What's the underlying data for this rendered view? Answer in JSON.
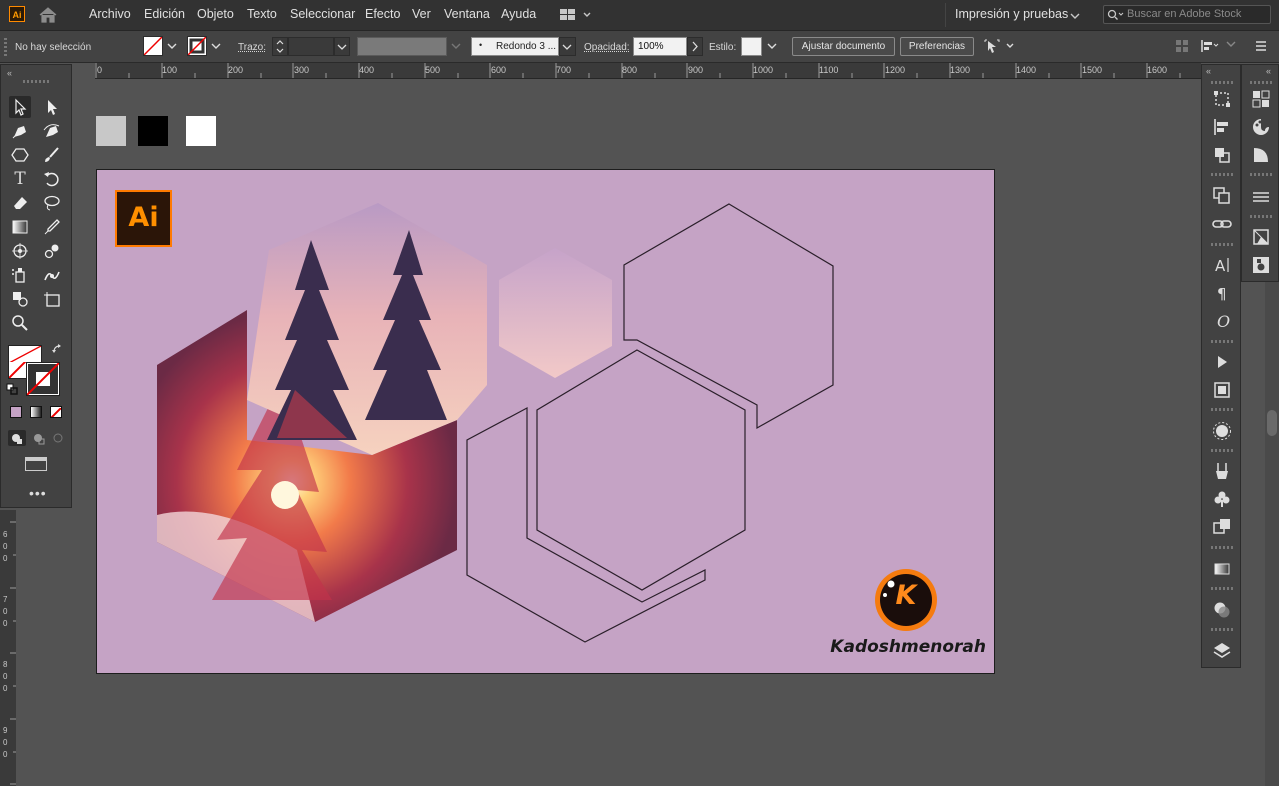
{
  "app": {
    "badge": "Ai",
    "brand_color": "#ff9a00"
  },
  "menu": {
    "items": [
      "Archivo",
      "Edición",
      "Objeto",
      "Texto",
      "Seleccionar",
      "Efecto",
      "Ver",
      "Ventana",
      "Ayuda"
    ],
    "workspace": "Impresión y pruebas",
    "search_placeholder": "Buscar en Adobe Stock"
  },
  "control": {
    "selection": "No hay selección",
    "stroke_label": "Trazo:",
    "brush": "Redondo 3 ...",
    "opacity_label": "Opacidad:",
    "opacity": "100%",
    "style_label": "Estilo:",
    "fit_doc": "Ajustar documento",
    "prefs": "Preferencias"
  },
  "ruler": {
    "top": [
      "0",
      "100",
      "200",
      "300",
      "400",
      "500",
      "600",
      "700",
      "800",
      "900",
      "1000",
      "1100",
      "1200",
      "1300",
      "1400",
      "1500",
      "1600"
    ],
    "left": [
      "6",
      "0",
      "0",
      "7",
      "0",
      "0",
      "8",
      "0",
      "0",
      "9",
      "0",
      "0"
    ]
  },
  "swatches": [
    "#c8c8c8",
    "#000000",
    "#ffffff"
  ],
  "artboard": {
    "background": "#c5a3c5",
    "logo_text": "Ai",
    "brand_letter": "K",
    "brand_name": "Kadoshmenorah"
  }
}
